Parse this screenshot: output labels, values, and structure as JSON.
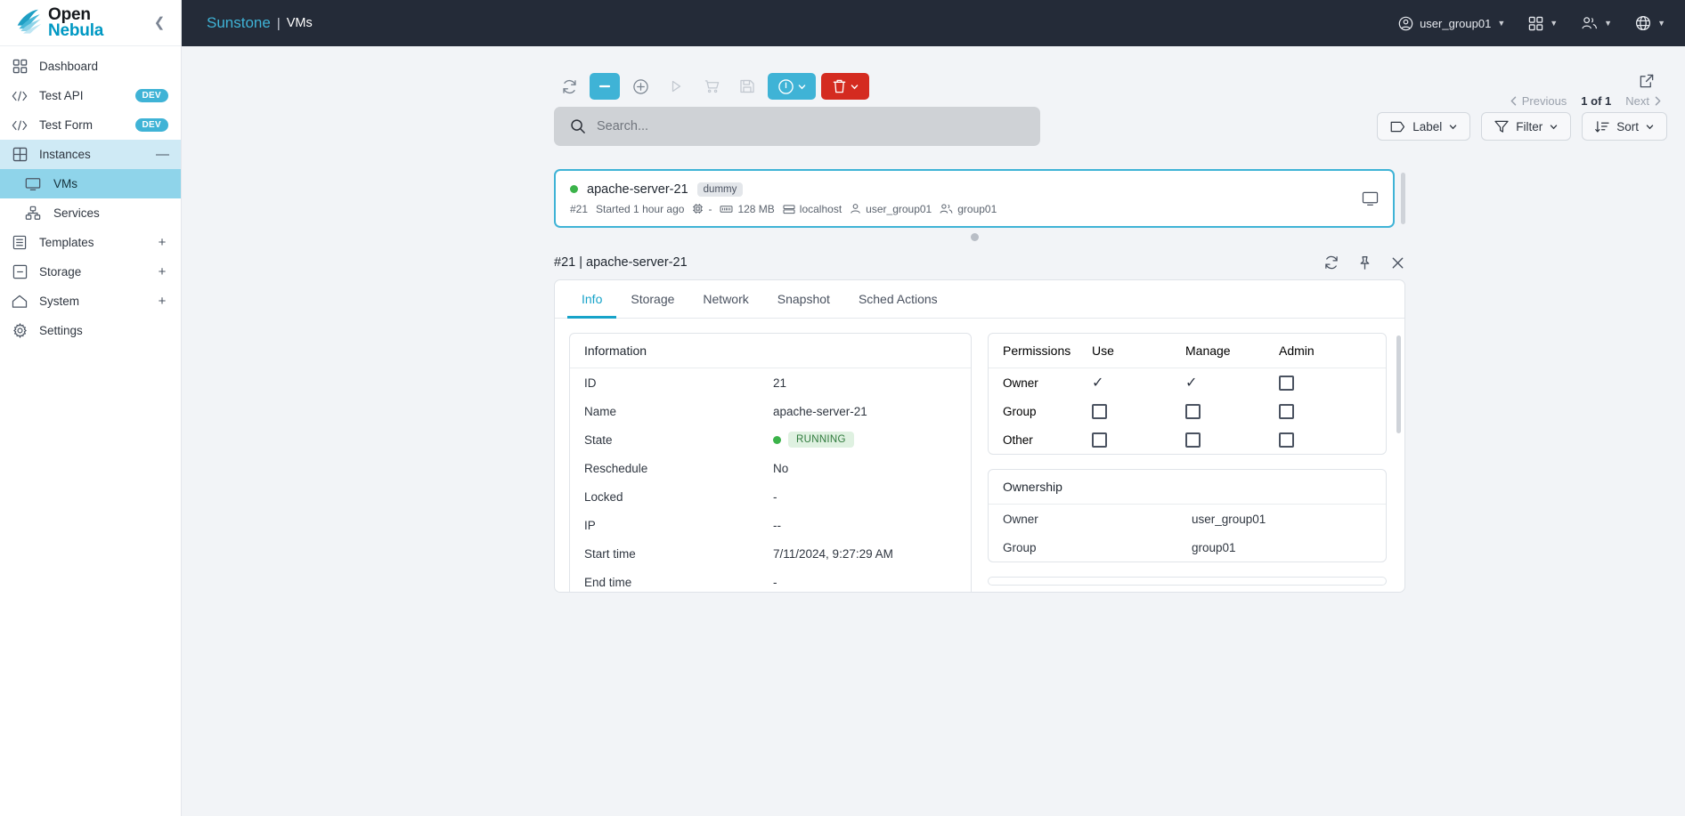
{
  "sidebar": {
    "logo": {
      "line1": "Open",
      "line2": "Nebula"
    },
    "collapse_icon": "chevron-left-icon",
    "items": [
      {
        "label": "Dashboard",
        "icon": "dashboard-icon",
        "badge": null,
        "sign": null,
        "state": "normal"
      },
      {
        "label": "Test API",
        "icon": "code-icon",
        "badge": "DEV",
        "sign": null,
        "state": "normal"
      },
      {
        "label": "Test Form",
        "icon": "code-icon",
        "badge": "DEV",
        "sign": null,
        "state": "normal"
      },
      {
        "label": "Instances",
        "icon": "grid-icon",
        "badge": null,
        "sign": "—",
        "state": "group-open"
      },
      {
        "label": "VMs",
        "icon": "monitor-icon",
        "badge": null,
        "sign": null,
        "state": "active-sub"
      },
      {
        "label": "Services",
        "icon": "services-icon",
        "badge": null,
        "sign": null,
        "state": "sub"
      },
      {
        "label": "Templates",
        "icon": "templates-icon",
        "badge": null,
        "sign": "+",
        "state": "normal"
      },
      {
        "label": "Storage",
        "icon": "storage-icon",
        "badge": null,
        "sign": "+",
        "state": "normal"
      },
      {
        "label": "System",
        "icon": "home-icon",
        "badge": null,
        "sign": "+",
        "state": "normal"
      },
      {
        "label": "Settings",
        "icon": "gear-icon",
        "badge": null,
        "sign": null,
        "state": "normal"
      }
    ]
  },
  "topbar": {
    "brand": "Sunstone",
    "separator": "|",
    "page": "VMs",
    "user": "user_group01",
    "user_icon": "user-circle-icon",
    "apps_icon": "apps-grid-icon",
    "group_icon": "people-icon",
    "language_icon": "globe-icon"
  },
  "toolbar": {
    "buttons": [
      {
        "name": "refresh-button",
        "icon": "refresh-icon",
        "style": "plain",
        "label": ""
      },
      {
        "name": "deselect-button",
        "icon": "minus-icon",
        "style": "selected",
        "label": ""
      },
      {
        "name": "create-button",
        "icon": "plus-circle-icon",
        "style": "plain",
        "label": ""
      },
      {
        "name": "play-button",
        "icon": "play-icon",
        "style": "disabled",
        "label": ""
      },
      {
        "name": "cart-button",
        "icon": "cart-icon",
        "style": "disabled",
        "label": ""
      },
      {
        "name": "save-button",
        "icon": "floppy-disk-icon",
        "style": "disabled",
        "label": ""
      },
      {
        "name": "info-button",
        "icon": "power-circle-icon",
        "style": "info",
        "label": ""
      },
      {
        "name": "delete-button",
        "icon": "trash-icon",
        "style": "danger",
        "label": ""
      }
    ],
    "external_link_icon": "external-link-icon",
    "pager": {
      "previous": "Previous",
      "count": "1 of 1",
      "next": "Next"
    }
  },
  "search": {
    "placeholder": "Search...",
    "icon": "search-icon",
    "value": ""
  },
  "filters": [
    {
      "label": "Label",
      "icon": "tag-icon"
    },
    {
      "label": "Filter",
      "icon": "funnel-icon"
    },
    {
      "label": "Sort",
      "icon": "sort-icon"
    }
  ],
  "vm_list": [
    {
      "name": "apache-server-21",
      "tag": "dummy",
      "state_color": "#3bb34a",
      "id": "#21",
      "started": "Started 1 hour ago",
      "cpu": "-",
      "memory": "128 MB",
      "host": "localhost",
      "owner": "user_group01",
      "group": "group01",
      "row_icon": "monitor-icon"
    }
  ],
  "detail": {
    "title": "#21 | apache-server-21",
    "actions": {
      "refresh_icon": "refresh-icon",
      "pin_icon": "pin-icon",
      "close_icon": "close-icon"
    },
    "tabs": [
      {
        "label": "Info",
        "active": true
      },
      {
        "label": "Storage",
        "active": false
      },
      {
        "label": "Network",
        "active": false
      },
      {
        "label": "Snapshot",
        "active": false
      },
      {
        "label": "Sched Actions",
        "active": false
      }
    ],
    "information": {
      "title": "Information",
      "rows": [
        {
          "key": "ID",
          "value": "21",
          "type": "text"
        },
        {
          "key": "Name",
          "value": "apache-server-21",
          "type": "text"
        },
        {
          "key": "State",
          "value": "RUNNING",
          "type": "state"
        },
        {
          "key": "Reschedule",
          "value": "No",
          "type": "text"
        },
        {
          "key": "Locked",
          "value": "-",
          "type": "text"
        },
        {
          "key": "IP",
          "value": "--",
          "type": "text"
        },
        {
          "key": "Start time",
          "value": "7/11/2024, 9:27:29 AM",
          "type": "text"
        },
        {
          "key": "End time",
          "value": "-",
          "type": "text"
        }
      ]
    },
    "permissions": {
      "title": "Permissions",
      "columns": [
        "Use",
        "Manage",
        "Admin"
      ],
      "rows": [
        {
          "key": "Owner",
          "values": [
            "check",
            "check",
            "box"
          ]
        },
        {
          "key": "Group",
          "values": [
            "box",
            "box",
            "box"
          ]
        },
        {
          "key": "Other",
          "values": [
            "box",
            "box",
            "box"
          ]
        }
      ]
    },
    "ownership": {
      "title": "Ownership",
      "rows": [
        {
          "key": "Owner",
          "value": "user_group01",
          "type": "link"
        },
        {
          "key": "Group",
          "value": "group01",
          "type": "text"
        }
      ]
    }
  },
  "colors": {
    "accent": "#3fb3d6",
    "danger": "#d42b20",
    "header_bg": "#242b38",
    "running": "#3bb34a",
    "link": "#17a3c9"
  }
}
